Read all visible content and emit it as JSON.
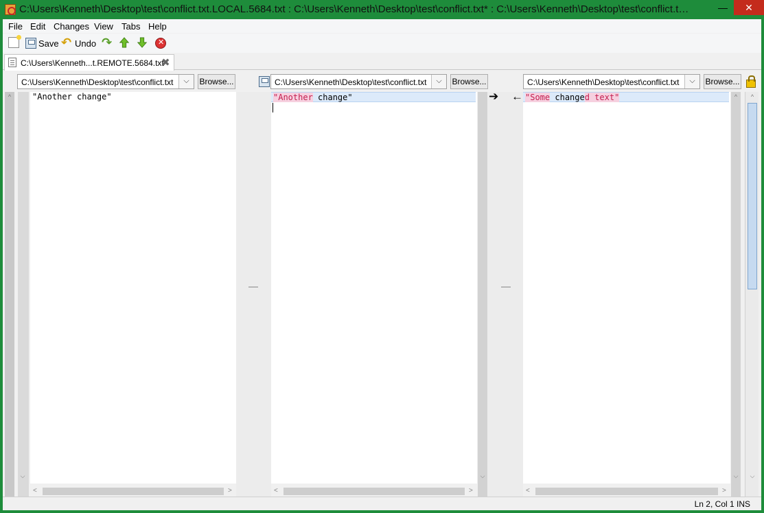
{
  "window": {
    "title": "C:\\Users\\Kenneth\\Desktop\\test\\conflict.txt.LOCAL.5684.txt : C:\\Users\\Kenneth\\Desktop\\test\\conflict.txt* : C:\\Users\\Kenneth\\Desktop\\test\\conflict.txt....",
    "minimize": "—",
    "maximize": "☐",
    "close": "✕"
  },
  "menu": [
    "File",
    "Edit",
    "Changes",
    "View",
    "Tabs",
    "Help"
  ],
  "toolbar": {
    "save_label": "Save",
    "undo_label": "Undo"
  },
  "tab": {
    "label": "C:\\Users\\Kenneth...t.REMOTE.5684.txt",
    "close": "✖"
  },
  "panes": [
    {
      "path": "C:\\Users\\Kenneth\\Desktop\\test\\conflict.txt",
      "browse": "Browse...",
      "line": "\"Another change\""
    },
    {
      "path": "C:\\Users\\Kenneth\\Desktop\\test\\conflict.txt",
      "browse": "Browse...",
      "line_parts": [
        "\"",
        "Another",
        " change\""
      ]
    },
    {
      "path": "C:\\Users\\Kenneth\\Desktop\\test\\conflict.txt",
      "browse": "Browse...",
      "line_parts": [
        "\"",
        "Some",
        " change",
        "d text",
        "\""
      ]
    }
  ],
  "merge": {
    "push_right": "➔",
    "push_left": "🡐"
  },
  "status": {
    "text": "Ln 2, Col 1  INS"
  }
}
